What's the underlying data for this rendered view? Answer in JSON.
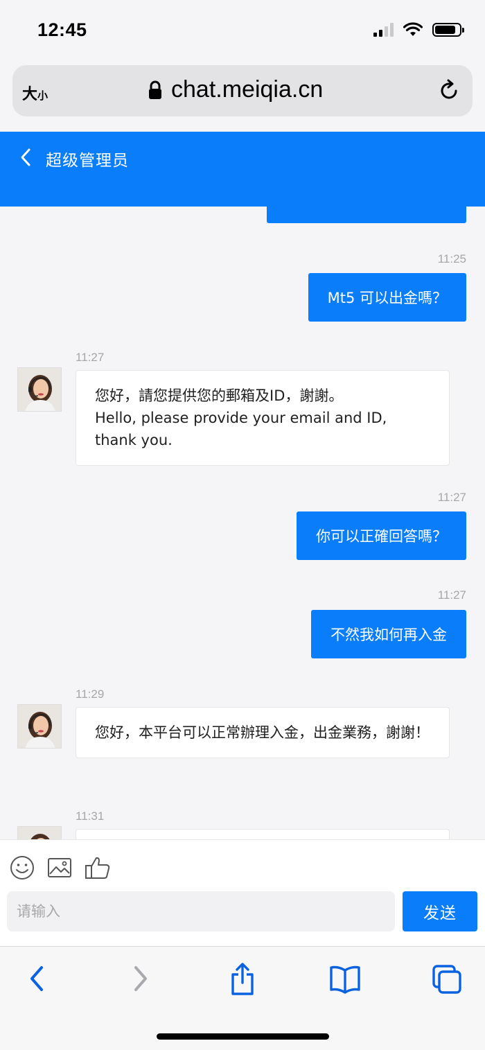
{
  "status_bar": {
    "time": "12:45",
    "battery_level": 0.85
  },
  "browser": {
    "text_size_label": "大",
    "text_size_small": "小",
    "url": "chat.meiqia.cn"
  },
  "header": {
    "title": "超级管理员"
  },
  "messages": [
    {
      "side": "out",
      "time": "11:25",
      "text": "Mt5 可以出金嗎？"
    },
    {
      "side": "in",
      "time": "11:27",
      "lines": [
        "您好，請您提供您的郵箱及ID，謝謝。",
        "Hello, please provide your email and ID, thank you."
      ]
    },
    {
      "side": "out",
      "time": "11:27",
      "text": "你可以正確回答嗎？"
    },
    {
      "side": "out",
      "time": "11:27",
      "text": "不然我如何再入金"
    },
    {
      "side": "in",
      "time": "11:29",
      "text": "您好，本平台可以正常辦理入金，出金業務，謝謝！"
    },
    {
      "side": "in",
      "time": "11:31",
      "text": ""
    }
  ],
  "composer": {
    "placeholder": "请输入",
    "send_label": "发送"
  },
  "icons": [
    "back-chevron-icon",
    "lock-icon",
    "reload-icon",
    "emoji-icon",
    "image-icon",
    "thumbs-up-icon",
    "share-icon",
    "bookmarks-icon",
    "tabs-icon"
  ],
  "colors": {
    "accent": "#0a7dfb",
    "background": "#f5f5f7",
    "timestamp": "#a6a6a6"
  }
}
